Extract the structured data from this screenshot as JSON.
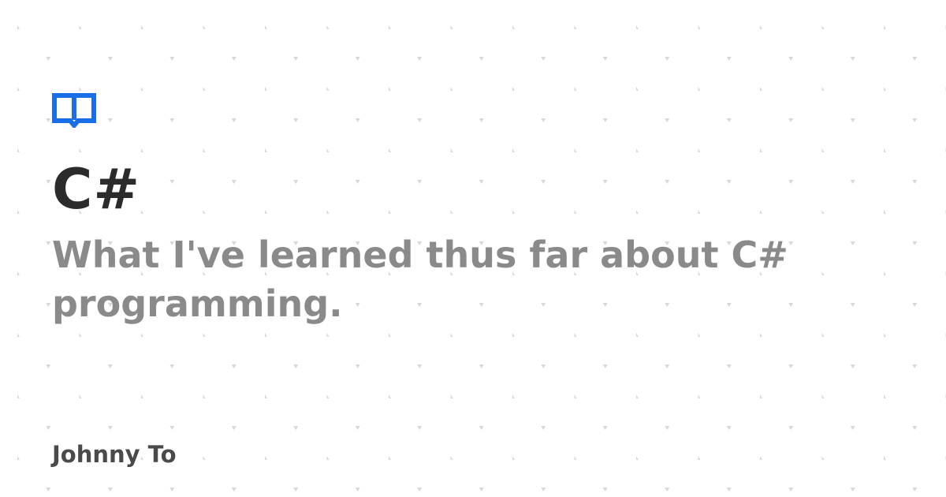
{
  "card": {
    "title": "C#",
    "subtitle": "What I've learned thus far about C# programming.",
    "author": "Johnny To"
  },
  "icons": {
    "logo": "book-icon"
  },
  "colors": {
    "background": "#ffffff",
    "accent": "#1a6fe8",
    "title": "#2b2b2b",
    "subtitle": "#8a8a8a",
    "author": "#4a4a4a",
    "pattern": "#d8d8d8"
  }
}
